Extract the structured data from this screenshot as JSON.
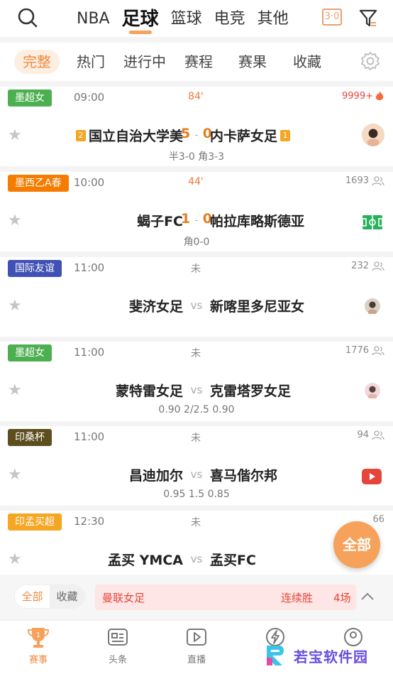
{
  "top": {
    "sports": [
      "NBA",
      "足球",
      "篮球",
      "电竞",
      "其他"
    ],
    "active_sport": "足球",
    "score_toggle": "3·0"
  },
  "subtabs": [
    "完整",
    "热门",
    "进行中",
    "赛程",
    "赛果",
    "收藏"
  ],
  "matches": [
    {
      "league": "墨超女",
      "league_color": "#4caf50",
      "time": "09:00",
      "status": "84'",
      "heat": "9999+",
      "home": "国立自治大学美",
      "away": "内卡萨女足",
      "home_rank": "2",
      "away_rank": "1",
      "score_home": "5",
      "score_away": "0",
      "sub": "半3-0 角3-3"
    },
    {
      "league": "墨西乙A春",
      "league_color": "#f57c00",
      "time": "10:00",
      "status": "44'",
      "heat": "1693",
      "home": "蝎子FC",
      "away": "帕拉库略斯德亚",
      "score_home": "1",
      "score_away": "0",
      "sub": "角0-0"
    },
    {
      "league": "国际友谊",
      "league_color": "#3f51b5",
      "time": "11:00",
      "status": "未",
      "heat": "232",
      "home": "斐济女足",
      "away": "新喀里多尼亚女",
      "vs": "vs",
      "sub": ""
    },
    {
      "league": "墨超女",
      "league_color": "#4caf50",
      "time": "11:00",
      "status": "未",
      "heat": "1776",
      "home": "蒙特雷女足",
      "away": "克雷塔罗女足",
      "vs": "vs",
      "sub": "0.90  2/2.5  0.90"
    },
    {
      "league": "印桑杯",
      "league_color": "#5d4e1e",
      "time": "11:00",
      "status": "未",
      "heat": "94",
      "home": "昌迪加尔",
      "away": "喜马偕尔邦",
      "vs": "vs",
      "sub": "0.95  1.5  0.85"
    },
    {
      "league": "印孟买超",
      "league_color": "#f5a623",
      "time": "12:30",
      "status": "未",
      "heat": "66",
      "home": "孟买 YMCA",
      "away": "孟买FC",
      "vs": "vs",
      "sub": ""
    }
  ],
  "fab": "全部",
  "filterbar": {
    "seg_all": "全部",
    "seg_fav": "收藏",
    "streak_team": "曼联女足",
    "streak_label": "连续胜",
    "streak_count": "4场"
  },
  "bottomnav": [
    {
      "label": "赛事"
    },
    {
      "label": "头条"
    },
    {
      "label": "直播"
    },
    {
      "label": ""
    },
    {
      "label": ""
    }
  ],
  "watermark": "若宝软件园",
  "colors": {
    "accent": "#ee8a3f",
    "score": "#e67e22",
    "hot": "#e5453a"
  }
}
